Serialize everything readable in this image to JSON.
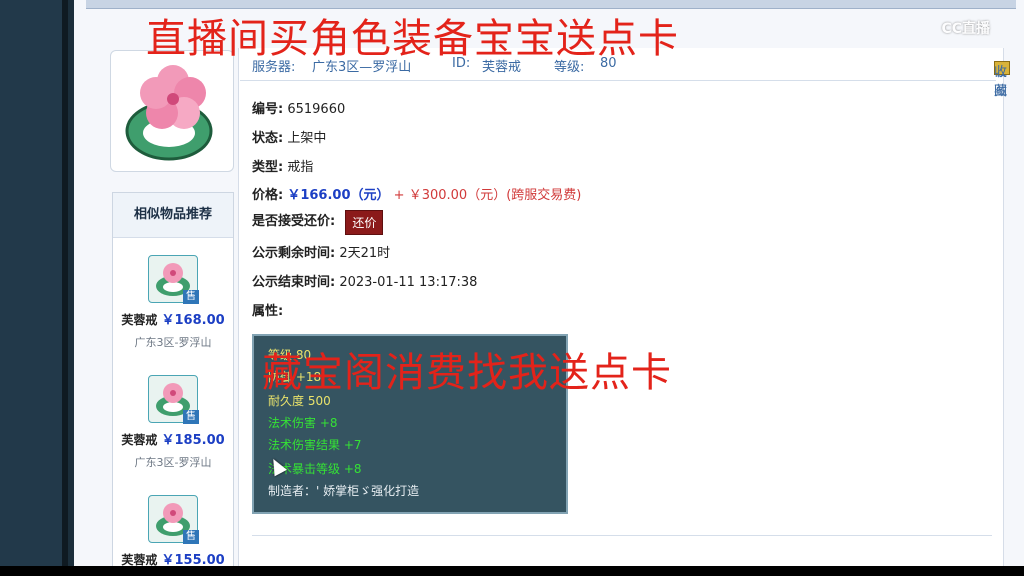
{
  "overlay": {
    "top_text": "直播间买角色装备宝宝送点卡",
    "mid_text": "藏宝阁消费找我送点卡"
  },
  "watermark": "CC直播",
  "info": {
    "server_label": "服务器:",
    "server_value": "广东3区—罗浮山",
    "id_label": "ID:",
    "id_value": "芙蓉戒",
    "level_label": "等级:",
    "level_value": "80"
  },
  "tools": [
    "截图",
    "收藏"
  ],
  "fields": {
    "number_label": "编号:",
    "number_value": "6519660",
    "status_label": "状态:",
    "status_value": "上架中",
    "type_label": "类型:",
    "type_value": "戒指",
    "price_label": "价格:",
    "price_value": "￥166.00（元）",
    "price_plus": "+",
    "fee_value": "￥300.00（元）(跨服交易费)",
    "haggle_label": "是否接受还价:",
    "haggle_button": "还价",
    "remain_label": "公示剩余时间:",
    "remain_value": "2天21时",
    "end_label": "公示结束时间:",
    "end_value": "2023-01-11 13:17:38",
    "attr_label": "属性:"
  },
  "tooltip": {
    "line1": "等级 80",
    "line2": "防御 +18",
    "line3": "耐久度 500",
    "line4": "法术伤害 +8",
    "line5": "法术伤害结果 +7",
    "line6": "法术暴击等级 +8",
    "line7": "制造者：' 娇掌柜ゞ强化打造"
  },
  "similar": {
    "header": "相似物品推荐",
    "sale_tag": "售",
    "items": [
      {
        "name": "芙蓉戒",
        "price": "￥168.00",
        "server": "广东3区-罗浮山"
      },
      {
        "name": "芙蓉戒",
        "price": "￥185.00",
        "server": "广东3区-罗浮山"
      },
      {
        "name": "芙蓉戒",
        "price": "￥155.00",
        "server": ""
      }
    ]
  },
  "colors": {
    "accent_red": "#e3231a",
    "price_blue": "#1c3fc4",
    "tooltip_bg": "#355461"
  }
}
